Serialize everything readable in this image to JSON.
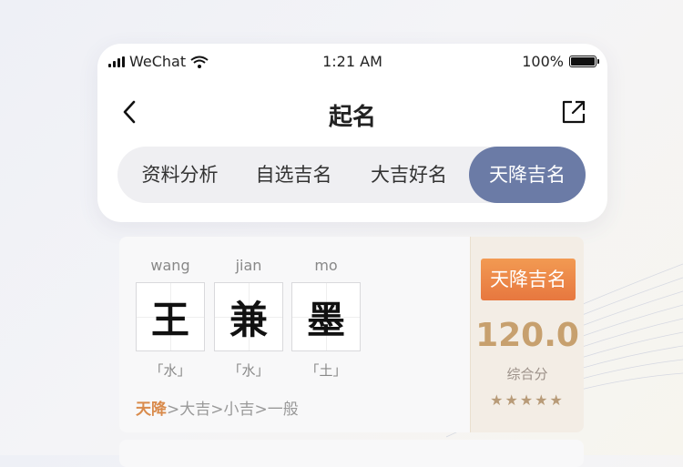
{
  "status_bar": {
    "carrier": "WeChat",
    "time": "1:21 AM",
    "battery": "100%"
  },
  "nav": {
    "title": "起名"
  },
  "tabs": [
    {
      "label": "资料分析"
    },
    {
      "label": "自选吉名"
    },
    {
      "label": "大吉好名"
    },
    {
      "label": "天降吉名",
      "active": true
    }
  ],
  "name_card": {
    "characters": [
      {
        "pinyin": "wang",
        "char": "王",
        "element": "「水」"
      },
      {
        "pinyin": "jian",
        "char": "兼",
        "element": "「水」"
      },
      {
        "pinyin": "mo",
        "char": "墨",
        "element": "「土」"
      }
    ],
    "level_highlight": "天降",
    "level_rest": ">大吉>小吉>一般",
    "badge": "天降吉名",
    "score": "120.0",
    "score_label": "综合分",
    "stars": "★★★★★"
  },
  "colors": {
    "tab_active": "#6b7ba6",
    "badge": "#e7773f",
    "score": "#c7a06e",
    "highlight": "#d98b4c"
  }
}
